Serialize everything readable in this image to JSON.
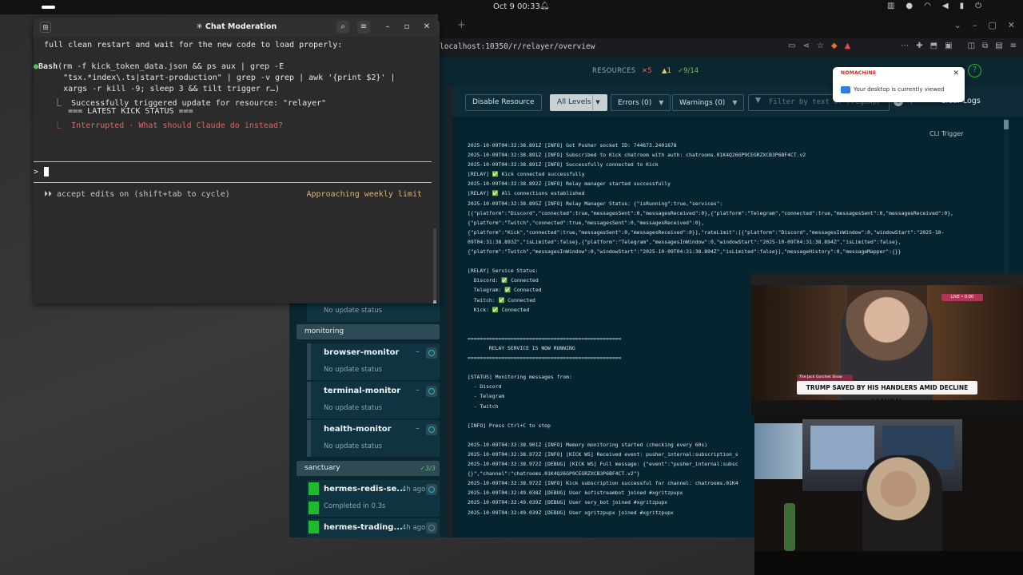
{
  "topbar": {
    "clock": "Oct 9  00:33"
  },
  "browser": {
    "url": "localhost:10350/r/relayer/overview"
  },
  "tilt": {
    "resources_label": "RESOURCES",
    "errors": "✕5",
    "warnings": "▲1",
    "ok": "✓9/14",
    "help": "?"
  },
  "filterbar": {
    "disable": "Disable Resource",
    "levels": "All Levels",
    "errors": "Errors (0)",
    "warnings": "Warnings (0)",
    "filter_placeholder": "Filter by text or /regexp/",
    "aa": "|  A",
    "clear": "Clear Logs",
    "cli_trigger": "CLI Trigger"
  },
  "log": {
    "lines": [
      "2025-10-09T04:32:38.891Z [INFO] Got Pusher socket ID: 744673.2401678",
      "2025-10-09T04:32:38.891Z [INFO] Subscribed to Kick chatroom with auth: chatrooms.01K4Q26GP9CEGRZXCB3P6BF4CT.v2",
      "2025-10-09T04:32:38.891Z [INFO] Successfully connected to Kick",
      "[RELAY] ✅ Kick connected successfully",
      "2025-10-09T04:32:38.892Z [INFO] Relay manager started successfully",
      "[RELAY] ✅ All connections established",
      "2025-10-09T04:32:38.895Z [INFO] Relay Manager Status: {\"isRunning\":true,\"services\":",
      "[{\"platform\":\"Discord\",\"connected\":true,\"messagesSent\":0,\"messagesReceived\":0},{\"platform\":\"Telegram\",\"connected\":true,\"messagesSent\":0,\"messagesReceived\":0},",
      "{\"platform\":\"Twitch\",\"connected\":true,\"messagesSent\":0,\"messagesReceived\":0},",
      "{\"platform\":\"Kick\",\"connected\":true,\"messagesSent\":0,\"messagesReceived\":0}],\"rateLimit\":[{\"platform\":\"Discord\",\"messagesInWindow\":0,\"windowStart\":\"2025-10-",
      "09T04:31:38.893Z\",\"isLimited\":false},{\"platform\":\"Telegram\",\"messagesInWindow\":0,\"windowStart\":\"2025-10-09T04:31:38.894Z\",\"isLimited\":false},",
      "{\"platform\":\"Twitch\",\"messagesInWindow\":0,\"windowStart\":\"2025-10-09T04:31:38.894Z\",\"isLimited\":false}],\"messageHistory\":0,\"messageMapper\":{}}",
      "",
      "[RELAY] Service Status:",
      "  Discord: ✅ Connected",
      "  Telegram: ✅ Connected",
      "  Twitch: ✅ Connected",
      "  Kick: ✅ Connected",
      "",
      "",
      "==================================================",
      "       RELAY SERVICE IS NOW RUNNING",
      "==================================================",
      "",
      "[STATUS] Monitoring messages from:",
      "  - Discord",
      "  - Telegram",
      "  - Twitch",
      "",
      "[INFO] Press Ctrl+C to stop",
      "",
      "2025-10-09T04:32:38.901Z [INFO] Memory monitoring started (checking every 60s)",
      "2025-10-09T04:32:38.972Z [INFO] [KICK WS] Received event: pusher_internal:subscription_s",
      "2025-10-09T04:32:38.972Z [DEBUG] [KICK WS] Full message: {\"event\":\"pusher_internal:subsc",
      "{}\",\"channel\":\"chatrooms.01K4Q26GP9CEGRZXCB3P6BF4CT.v2\"}",
      "2025-10-09T04:32:38.972Z [INFO] Kick subscription successful for channel: chatrooms.01K4",
      "2025-10-09T04:32:49.038Z [DEBUG] User kofistreambot joined #xgritzpupx",
      "2025-10-09T04:32:49.039Z [DEBUG] User sery_bot joined #xgritzpupx",
      "2025-10-09T04:32:49.039Z [DEBUG] User xgritzpupx joined #xgritzpupx"
    ]
  },
  "resources": {
    "first_status": "No update status",
    "groups": [
      {
        "name": "monitoring",
        "count": ""
      },
      {
        "name": "sanctuary",
        "count": "✓3/3"
      }
    ],
    "items": [
      {
        "title": "browser-monitor",
        "status": "No update status",
        "age": ""
      },
      {
        "title": "terminal-monitor",
        "status": "No update status",
        "age": ""
      },
      {
        "title": "health-monitor",
        "status": "No update status",
        "age": ""
      },
      {
        "title": "hermes-redis-se...",
        "status": "Completed in 0.3s",
        "age": "4h ago"
      },
      {
        "title": "hermes-trading...",
        "status": "",
        "age": "4h ago"
      }
    ]
  },
  "terminal": {
    "title": "✳ Chat Moderation",
    "line1": "full clean restart and wait for the new code to load properly:",
    "bash_label": "Bash",
    "bash_cmd1": "(rm -f kick_token_data.json && ps aux | grep -E",
    "bash_cmd2": "    \"tsx.*index\\.ts|start-production\" | grep -v grep | awk '{print $2}' |",
    "bash_cmd3": "    xargs -r kill -9; sleep 3 && tilt trigger r…)",
    "out1": "  ⎿  Successfully triggered update for resource: \"relayer\"",
    "out2": "     === LATEST KICK STATUS ===",
    "out3": "  ⎿  Interrupted · What should Claude do instead?",
    "prompt": ">",
    "accept": "⏵⏵ accept edits on (shift+tab to cycle)",
    "limit": "Approaching weekly limit"
  },
  "notification": {
    "brand": "NOMACHINE",
    "message": "Your desktop is currently viewed"
  },
  "video": {
    "tag": "LIVE • 0:00",
    "chyron": "The Jack Gorchek Show",
    "headline": "TRUMP SAVED BY HIS HANDLERS AMID DECLINE SCANDAL"
  }
}
